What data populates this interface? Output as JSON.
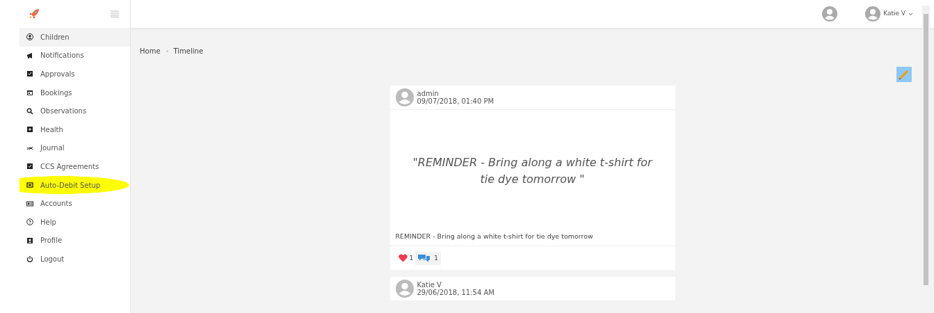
{
  "sidebar": {
    "items": [
      {
        "label": "Children",
        "selected": true,
        "highlighted": false
      },
      {
        "label": "Notifications",
        "selected": false,
        "highlighted": false
      },
      {
        "label": "Approvals",
        "selected": false,
        "highlighted": false
      },
      {
        "label": "Bookings",
        "selected": false,
        "highlighted": false
      },
      {
        "label": "Observations",
        "selected": false,
        "highlighted": false
      },
      {
        "label": "Health",
        "selected": false,
        "highlighted": false
      },
      {
        "label": "Journal",
        "selected": false,
        "highlighted": false
      },
      {
        "label": "CCS Agreements",
        "selected": false,
        "highlighted": false
      },
      {
        "label": "Auto-Debit Setup",
        "selected": false,
        "highlighted": true
      },
      {
        "label": "Accounts",
        "selected": false,
        "highlighted": false
      },
      {
        "label": "Help",
        "selected": false,
        "highlighted": false
      },
      {
        "label": "Profile",
        "selected": false,
        "highlighted": false
      },
      {
        "label": "Logout",
        "selected": false,
        "highlighted": false
      }
    ]
  },
  "header": {
    "user": "Katie V"
  },
  "breadcrumb": [
    "Home",
    "Timeline"
  ],
  "posts": [
    {
      "author": "admin",
      "time": "09/07/2018, 01:40 PM",
      "quote": "\"REMINDER - Bring along a white t-shirt for tie dye tomorrow \"",
      "text": "REMINDER - Bring along a white t-shirt for tie dye tomorrow",
      "likes": "1",
      "comments": "1"
    },
    {
      "author": "Katie V",
      "time": "29/06/2018, 11:54 AM"
    }
  ]
}
